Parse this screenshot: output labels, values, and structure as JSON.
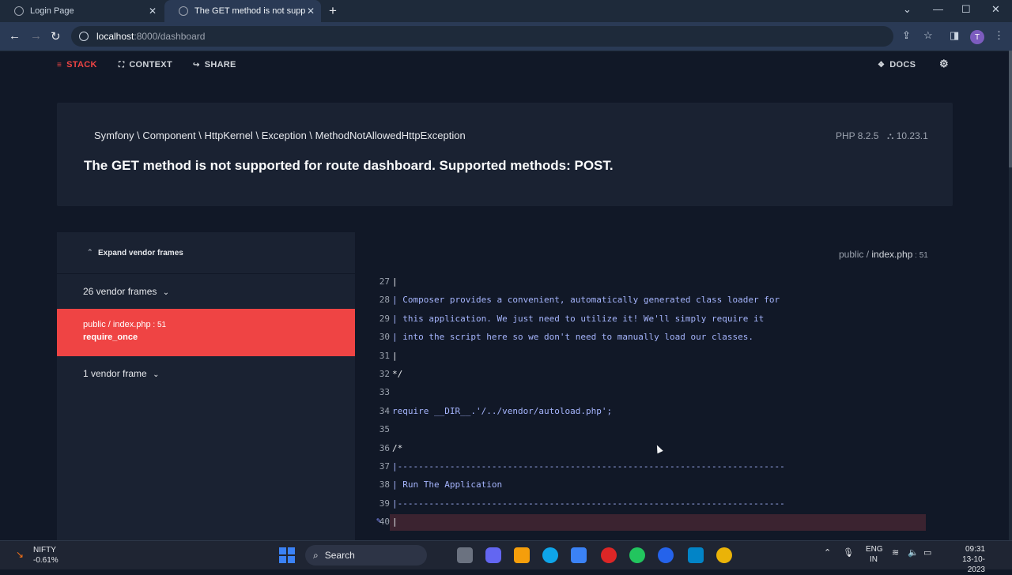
{
  "browser": {
    "tabs": [
      {
        "title": "Login Page"
      },
      {
        "title": "The GET method is not supported"
      }
    ],
    "url_host": "localhost",
    "url_path": ":8000/dashboard",
    "avatar_letter": "T"
  },
  "nav": {
    "stack": "STACK",
    "context": "CONTEXT",
    "share": "SHARE",
    "docs": "DOCS"
  },
  "exception": {
    "class": "Symfony \\ Component \\ HttpKernel \\ Exception \\ MethodNotAllowedHttpException",
    "php_version": "PHP 8.2.5",
    "laravel_version": "10.23.1",
    "message": "The GET method is not supported for route dashboard. Supported methods: POST."
  },
  "stack": {
    "expand_label": "Expand vendor frames",
    "vendor_group_1": "26 vendor frames",
    "active_frame": {
      "path_prefix": "public / ",
      "file": "index.php",
      "line": "51",
      "method": "require_once"
    },
    "vendor_group_2": "1 vendor frame",
    "file_header": {
      "path_prefix": "public / ",
      "file": "index.php",
      "line": "51"
    }
  },
  "code": [
    {
      "n": "27",
      "t": "|"
    },
    {
      "n": "28",
      "t": "| Composer provides a convenient, automatically generated class loader for"
    },
    {
      "n": "29",
      "t": "| this application. We just need to utilize it! We'll simply require it"
    },
    {
      "n": "30",
      "t": "| into the script here so we don't need to manually load our classes."
    },
    {
      "n": "31",
      "t": "|"
    },
    {
      "n": "32",
      "t": "*/"
    },
    {
      "n": "33",
      "t": ""
    },
    {
      "n": "34",
      "t": "require __DIR__.'/../vendor/autoload.php';"
    },
    {
      "n": "35",
      "t": ""
    },
    {
      "n": "36",
      "t": "/*"
    },
    {
      "n": "37",
      "t": "|--------------------------------------------------------------------------"
    },
    {
      "n": "38",
      "t": "| Run The Application"
    },
    {
      "n": "39",
      "t": "|--------------------------------------------------------------------------"
    },
    {
      "n": "40",
      "t": "|"
    }
  ],
  "taskbar": {
    "ticker_name": "NIFTY",
    "ticker_change": "-0.61%",
    "search_label": "Search",
    "lang_top": "ENG",
    "lang_bottom": "IN",
    "time": "09:31",
    "date": "13-10-2023"
  }
}
